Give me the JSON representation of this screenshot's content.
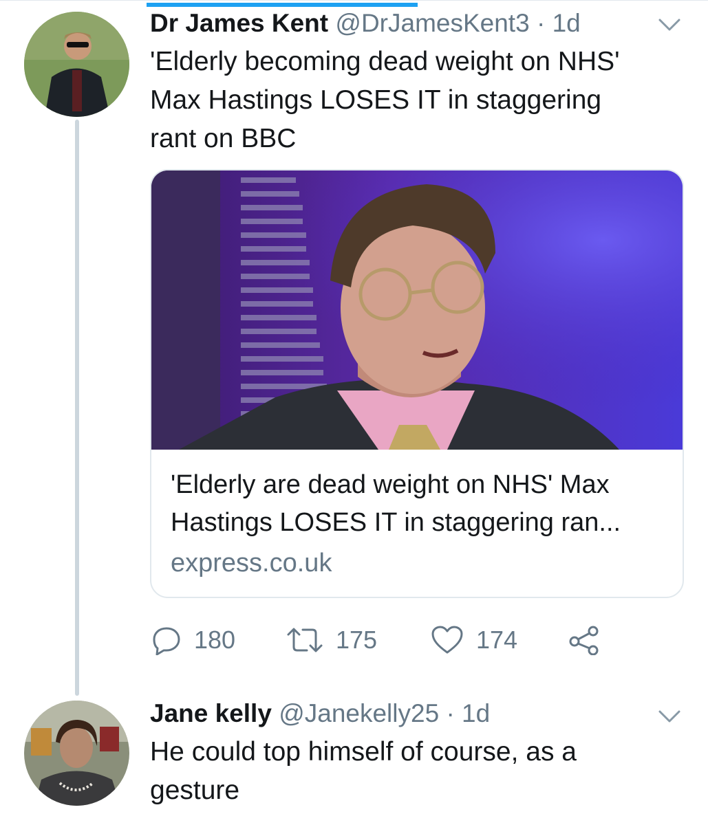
{
  "tweets": [
    {
      "author_name": "Dr James Kent",
      "handle": "@DrJamesKent3",
      "separator": "·",
      "time": "1d",
      "text_lines": [
        "'Elderly becoming dead weight on NHS'",
        "Max Hastings LOSES IT in staggering",
        "rant on BBC"
      ],
      "card": {
        "title_lines": [
          "'Elderly are dead weight on NHS' Max",
          "Hastings LOSES IT in staggering ran..."
        ],
        "domain": "express.co.uk"
      },
      "actions": {
        "replies": "180",
        "retweets": "175",
        "likes": "174"
      }
    },
    {
      "author_name": "Jane kelly",
      "handle": "@Janekelly25",
      "separator": "·",
      "time": "1d",
      "text_lines": [
        "He could top himself of course, as a",
        "gesture"
      ]
    }
  ],
  "icons": {
    "reply": "reply-icon",
    "retweet": "retweet-icon",
    "like": "heart-icon",
    "share": "share-icon",
    "more": "chevron-down-icon"
  },
  "colors": {
    "accent": "#1da1f2",
    "text": "#14171a",
    "secondary": "#657786",
    "border": "#e1e8ed",
    "thread_line": "#ccd6dd"
  }
}
